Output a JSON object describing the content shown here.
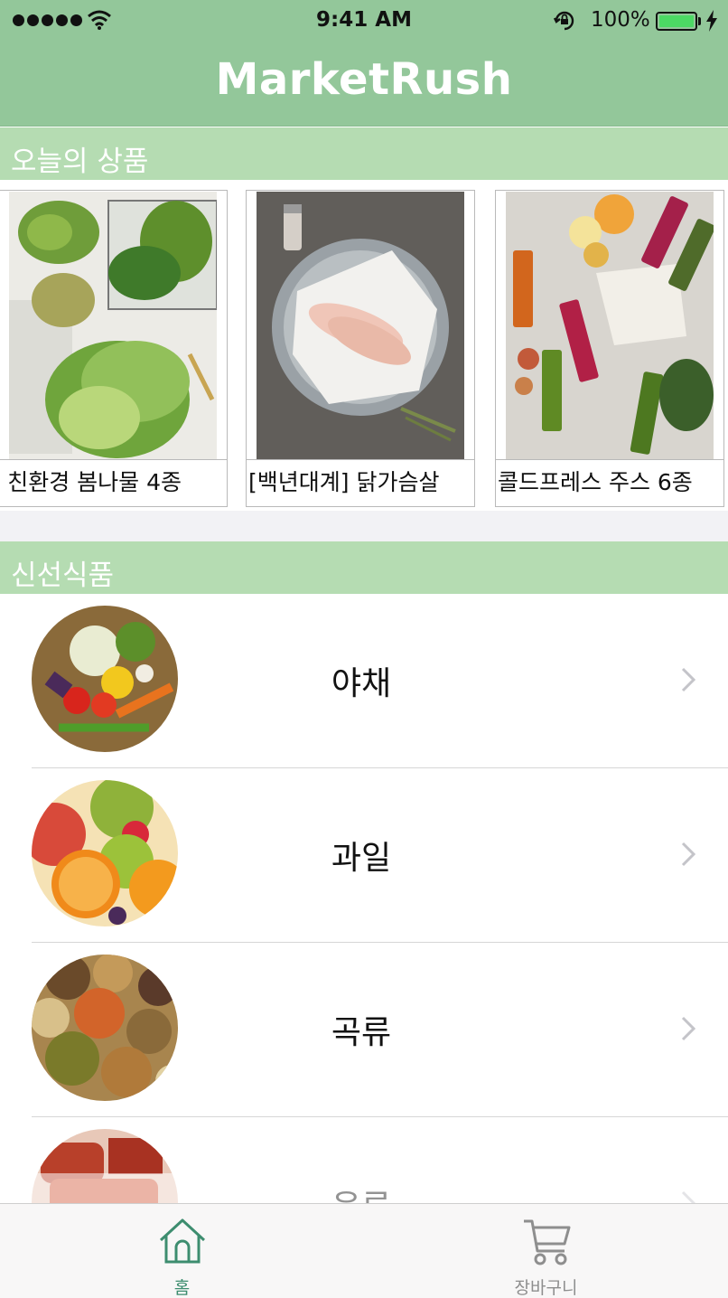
{
  "status_bar": {
    "time": "9:41 AM",
    "battery_percent": "100%",
    "signal_icon": "signal-dots-icon",
    "wifi_icon": "wifi-icon",
    "lock_icon": "rotation-lock-icon",
    "battery_icon": "battery-full-icon",
    "charging_icon": "charging-bolt-icon"
  },
  "header": {
    "title": "MarketRush",
    "color": "#93c79a"
  },
  "today": {
    "title": "오늘의 상품",
    "products": [
      {
        "name": "친환경 봄나물 4종",
        "image_icon": "greens-photo"
      },
      {
        "name": "[백년대계] 닭가슴살",
        "image_icon": "chicken-breast-photo"
      },
      {
        "name": "콜드프레스 주스 6종",
        "image_icon": "cold-press-juice-photo"
      }
    ]
  },
  "fresh": {
    "title": "신선식품",
    "categories": [
      {
        "label": "야채",
        "image_icon": "vegetables-photo"
      },
      {
        "label": "과일",
        "image_icon": "fruits-photo"
      },
      {
        "label": "곡류",
        "image_icon": "grains-photo"
      },
      {
        "label": "육류",
        "image_icon": "meat-photo"
      }
    ]
  },
  "tab_bar": {
    "tabs": [
      {
        "label": "홈",
        "icon": "home-icon",
        "active": true
      },
      {
        "label": "장바구니",
        "icon": "cart-icon",
        "active": false
      }
    ],
    "active_color": "#3d8d6f",
    "inactive_color": "#8e8e8e"
  },
  "colors": {
    "accent": "#93c79a",
    "section_header": "#b5dcb2"
  }
}
